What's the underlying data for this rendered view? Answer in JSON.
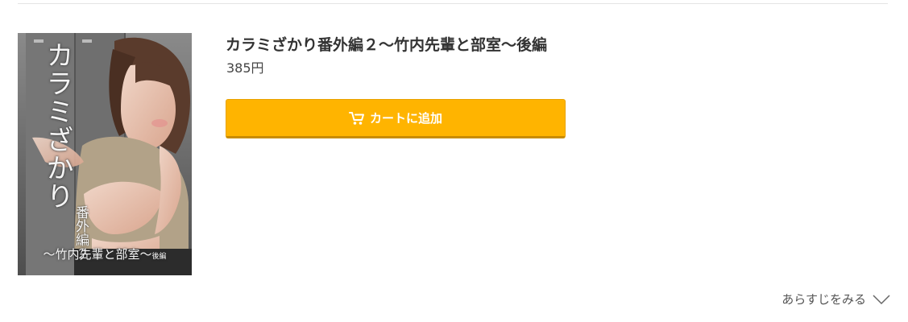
{
  "product": {
    "title": "カラミざかり番外編２～竹内先輩と部室～後編",
    "price": "385円",
    "cover": {
      "title": "カラミざかり",
      "subtitle": "番外編２",
      "episode": "～竹内先輩と部室～",
      "episode_suffix": "後編"
    }
  },
  "actions": {
    "add_to_cart_label": "カートに追加",
    "add_to_cart_icon": "cart-icon",
    "synopsis_label": "あらすじをみる",
    "synopsis_icon": "chevron-down-icon"
  },
  "colors": {
    "button_bg": "#ffb400",
    "button_text": "#ffffff",
    "text": "#333333"
  }
}
